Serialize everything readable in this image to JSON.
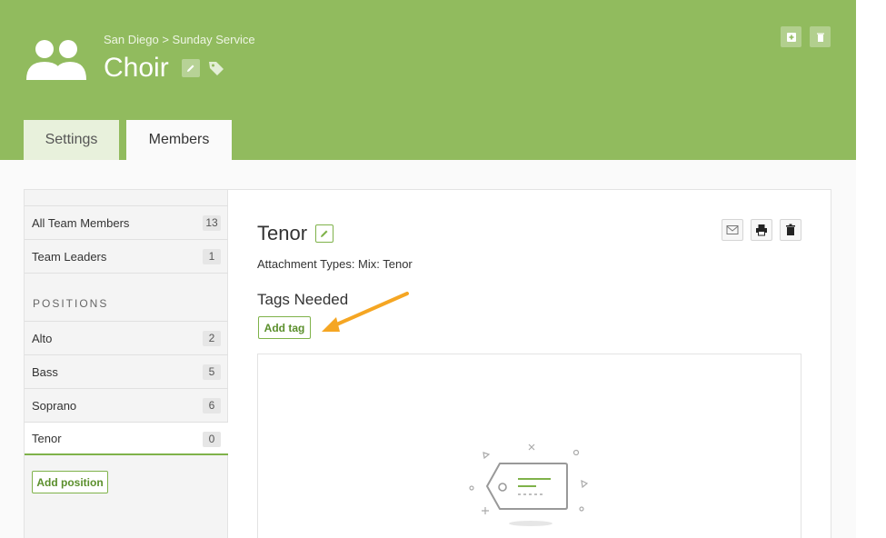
{
  "header": {
    "breadcrumb": "San Diego > Sunday Service",
    "title": "Choir",
    "color": "#91bb5e"
  },
  "header_actions": [
    {
      "icon": "add-icon"
    },
    {
      "icon": "trash-icon"
    }
  ],
  "tabs": [
    {
      "label": "Settings",
      "active": false
    },
    {
      "label": "Members",
      "active": true
    }
  ],
  "sidebar": {
    "groups": [
      {
        "label": "All Team Members",
        "count": "13"
      },
      {
        "label": "Team Leaders",
        "count": "1"
      }
    ],
    "section_label": "POSITIONS",
    "positions": [
      {
        "label": "Alto",
        "count": "2"
      },
      {
        "label": "Bass",
        "count": "5"
      },
      {
        "label": "Soprano",
        "count": "6"
      },
      {
        "label": "Tenor",
        "count": "0"
      }
    ],
    "add_position_label": "Add position"
  },
  "main": {
    "position_title": "Tenor",
    "attachment_types": "Attachment Types: Mix: Tenor",
    "tags_heading": "Tags Needed",
    "add_tag_label": "Add tag",
    "actions": [
      {
        "icon": "mail-icon"
      },
      {
        "icon": "print-icon"
      },
      {
        "icon": "trash-icon"
      }
    ]
  },
  "accent_color": "#7fb24a",
  "annotation_color": "#f5a623"
}
